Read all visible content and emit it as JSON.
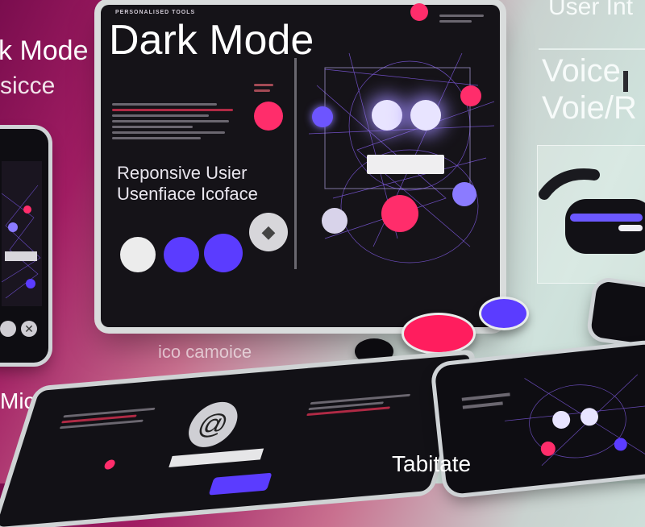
{
  "left_caption": {
    "line1": "k Mode",
    "line2": "sicce"
  },
  "main_panel": {
    "header_text": "PERSONALISED TOOLS",
    "title": "Dark Mode",
    "subtitle_line1": "Reponsive Usier",
    "subtitle_line2": "Usenfiace Icoface"
  },
  "right_caption": {
    "top": "User Int",
    "voice1": "Voice",
    "voice2": "Voie/R"
  },
  "bottom_left_label": "Micros",
  "bottom_left_label_fade": "ico  camoice",
  "bottom_right_label": "Tabitate",
  "colors": {
    "pink": "#ff2d6b",
    "purple": "#5b3cff",
    "lavender": "#8b7bff",
    "panel": "#151318"
  },
  "icons": [
    "robot-icon",
    "spiral-icon",
    "vr-headset-icon",
    "close-icon",
    "diamond-icon"
  ]
}
